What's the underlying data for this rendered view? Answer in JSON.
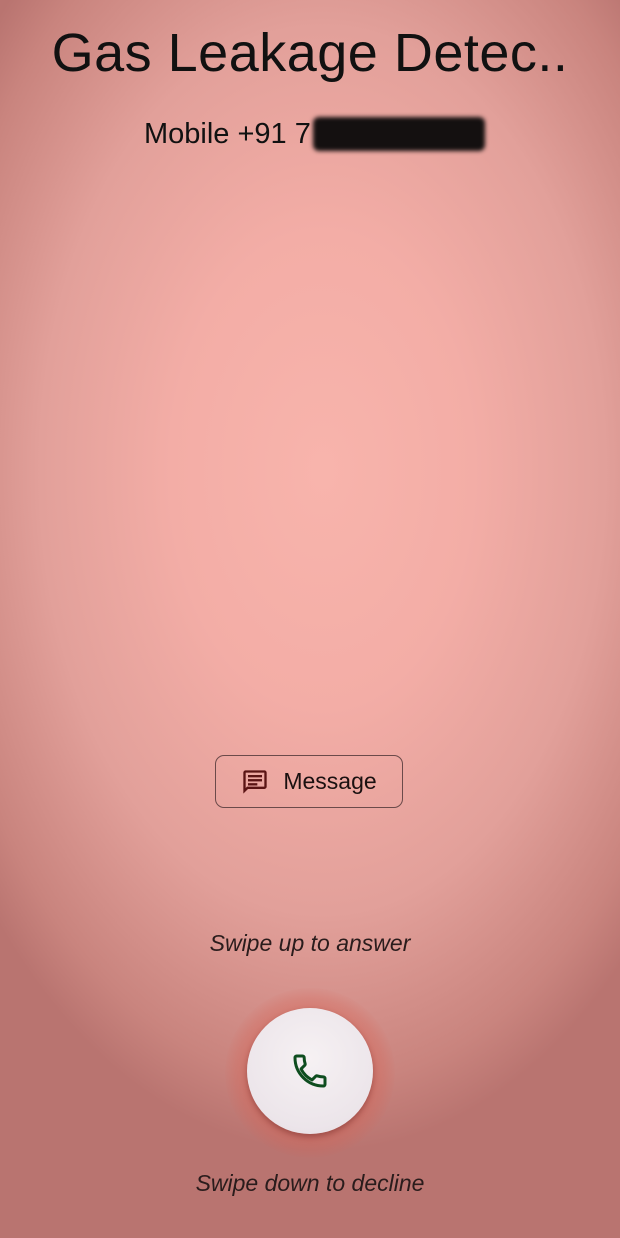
{
  "caller": {
    "name": "Gas Leakage Detec..",
    "number_label": "Mobile +91 7"
  },
  "actions": {
    "message_label": "Message",
    "message_icon": "message-icon",
    "answer_icon": "phone-icon"
  },
  "hints": {
    "answer": "Swipe up to answer",
    "decline": "Swipe down to decline"
  },
  "colors": {
    "accent_icon": "#0e4d1f",
    "message_icon": "#5a1414",
    "background": "#f3ada6"
  }
}
